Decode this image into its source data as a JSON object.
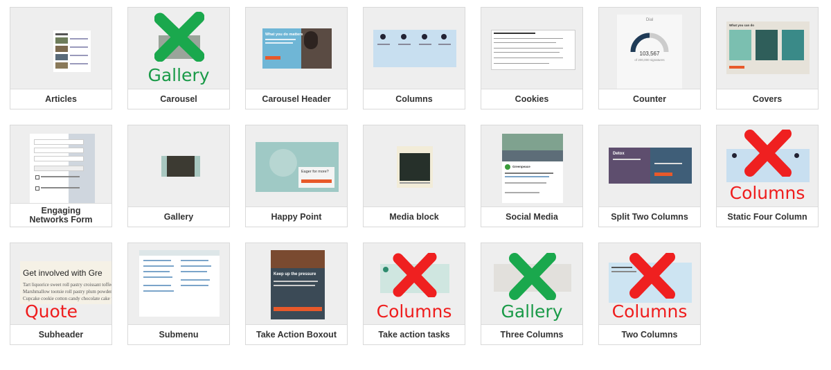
{
  "blocks": [
    {
      "label": "Articles"
    },
    {
      "label": "Carousel",
      "overlay": "Gallery",
      "overlay_color": "green"
    },
    {
      "label": "Carousel Header",
      "preview_text": "What you do matters"
    },
    {
      "label": "Columns"
    },
    {
      "label": "Cookies"
    },
    {
      "label": "Counter",
      "preview_title": "Dial",
      "preview_value": "103,567",
      "preview_sub": "of 200,000 signatures"
    },
    {
      "label": "Covers",
      "preview_title": "What you can do"
    },
    {
      "label": "Engaging Networks Form"
    },
    {
      "label": "Gallery"
    },
    {
      "label": "Happy Point",
      "preview_text": "Eager for more?"
    },
    {
      "label": "Media block"
    },
    {
      "label": "Social Media",
      "preview_name": "Greenpeace"
    },
    {
      "label": "Split Two Columns",
      "preview_text": "Detox"
    },
    {
      "label": "Static Four Column",
      "overlay": "Columns",
      "overlay_color": "red"
    },
    {
      "label": "Subheader",
      "overlay": "Quote",
      "overlay_color": "red",
      "preview_heading": "Get involved with Gre",
      "preview_lines": [
        "Tart liquorice sweet roll pastry croissant toffee c",
        "Marshmallow tootsie roll pastry plum powder ca",
        "Cupcake cookie cotton candy chocolate cake w"
      ]
    },
    {
      "label": "Submenu"
    },
    {
      "label": "Take Action Boxout",
      "preview_text": "Keep up the pressure"
    },
    {
      "label": "Take action tasks",
      "overlay": "Columns",
      "overlay_color": "red"
    },
    {
      "label": "Three Columns",
      "overlay": "Gallery",
      "overlay_color": "green"
    },
    {
      "label": "Two Columns",
      "overlay": "Columns",
      "overlay_color": "red"
    }
  ],
  "colors": {
    "green_mark": "#1aa84d",
    "red_mark": "#ef2020",
    "accent_orange": "#e8592a"
  }
}
